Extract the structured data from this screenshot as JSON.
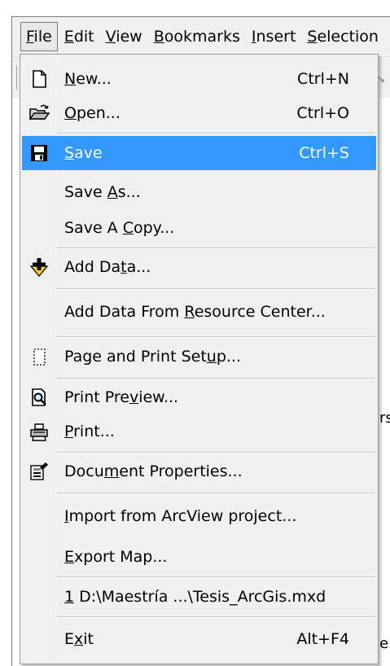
{
  "menubar": {
    "items": [
      {
        "label": "File",
        "underline": "F"
      },
      {
        "label": "Edit",
        "underline": "E"
      },
      {
        "label": "View",
        "underline": "V"
      },
      {
        "label": "Bookmarks",
        "underline": "B"
      },
      {
        "label": "Insert",
        "underline": "I"
      },
      {
        "label": "Selection",
        "underline": "S"
      }
    ]
  },
  "background": {
    "fragment_1": "rsa",
    "fragment_2": "e"
  },
  "file_menu": {
    "items": [
      {
        "id": "new",
        "pre": "",
        "u": "N",
        "post": "ew...",
        "shortcut": "Ctrl+N",
        "icon": "new-document-icon"
      },
      {
        "id": "open",
        "pre": "",
        "u": "O",
        "post": "pen...",
        "shortcut": "Ctrl+O",
        "icon": "open-folder-icon"
      },
      {
        "id": "save",
        "pre": "",
        "u": "S",
        "post": "ave",
        "shortcut": "Ctrl+S",
        "icon": "save-disk-icon"
      },
      {
        "id": "save-as",
        "pre": "Save ",
        "u": "A",
        "post": "s...",
        "shortcut": "",
        "icon": ""
      },
      {
        "id": "save-a-copy",
        "pre": "Save A ",
        "u": "C",
        "post": "opy...",
        "shortcut": "",
        "icon": ""
      },
      {
        "id": "add-data",
        "pre": "Add Da",
        "u": "t",
        "post": "a...",
        "shortcut": "",
        "icon": "add-data-icon"
      },
      {
        "id": "add-data-resource-center",
        "pre": "Add Data From ",
        "u": "R",
        "post": "esource Center...",
        "shortcut": "",
        "icon": ""
      },
      {
        "id": "page-print-setup",
        "pre": "Page and Print Set",
        "u": "u",
        "post": "p...",
        "shortcut": "",
        "icon": "page-setup-icon"
      },
      {
        "id": "print-preview",
        "pre": "Print Pre",
        "u": "v",
        "post": "iew...",
        "shortcut": "",
        "icon": "print-preview-icon"
      },
      {
        "id": "print",
        "pre": "",
        "u": "P",
        "post": "rint...",
        "shortcut": "",
        "icon": "printer-icon"
      },
      {
        "id": "document-properties",
        "pre": "Docu",
        "u": "m",
        "post": "ent Properties...",
        "shortcut": "",
        "icon": "document-properties-icon"
      },
      {
        "id": "import-arcview",
        "pre": "",
        "u": "I",
        "post": "mport from ArcView project...",
        "shortcut": "",
        "icon": ""
      },
      {
        "id": "export-map",
        "pre": "",
        "u": "E",
        "post": "xport Map...",
        "shortcut": "",
        "icon": ""
      },
      {
        "id": "recent-file-1",
        "pre": "",
        "u": "1",
        "post": " D:\\Maestría ...\\Tesis_ArcGis.mxd",
        "shortcut": "",
        "icon": ""
      },
      {
        "id": "exit",
        "pre": "E",
        "u": "x",
        "post": "it",
        "shortcut": "Alt+F4",
        "icon": ""
      }
    ]
  },
  "colors": {
    "highlight": "#3399ff",
    "menu_bg": "#f0f0f0",
    "add_data_icon": "#ffd400"
  }
}
